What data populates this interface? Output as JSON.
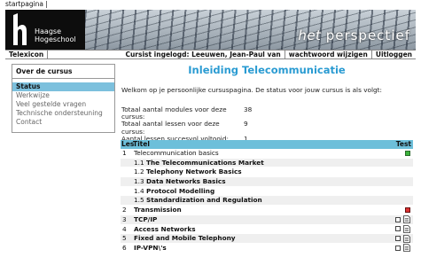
{
  "top": {
    "link": "startpagina",
    "separator": "|"
  },
  "banner": {
    "logo_line1": "Haagse",
    "logo_line2": "Hogeschool",
    "tagline_prefix": "het ",
    "tagline_main": "perspectief"
  },
  "navbar": {
    "brand": "Telexicon",
    "user": "Cursist ingelogd: Leeuwen, Jean-Paul van",
    "change_password": "wachtwoord wijzigen",
    "logout": "Uitloggen"
  },
  "sidebar": {
    "title": "Over de cursus",
    "items": [
      {
        "label": "Status",
        "active": true
      },
      {
        "label": "Werkwijze"
      },
      {
        "label": "Veel gestelde vragen"
      },
      {
        "label": "Technische ondersteuning"
      },
      {
        "label": "Contact"
      }
    ]
  },
  "main": {
    "title": "Inleiding Telecommunicatie",
    "intro": "Welkom op je persoonlijke cursuspagina. De status voor jouw cursus is als volgt:",
    "stats": [
      {
        "label": "Totaal aantal modules voor deze cursus:",
        "value": "38"
      },
      {
        "label": "Totaal aantal lessen voor deze cursus:",
        "value": "9"
      },
      {
        "label": "Aantal lessen succesvol voltooid:",
        "value": "1"
      }
    ],
    "table": {
      "headers": {
        "les": "Les",
        "title": "Titel",
        "test": "Test"
      },
      "rows": [
        {
          "les": "1",
          "num": "",
          "title": "Telecommunication basics",
          "bold": false,
          "alt": false,
          "status": "green",
          "doc": false
        },
        {
          "les": "",
          "num": "1.1",
          "title": "The Telecommunications Market",
          "bold": true,
          "alt": true,
          "status": "",
          "doc": false
        },
        {
          "les": "",
          "num": "1.2",
          "title": "Telephony Network Basics",
          "bold": true,
          "alt": false,
          "status": "",
          "doc": false
        },
        {
          "les": "",
          "num": "1.3",
          "title": "Data Networks Basics",
          "bold": true,
          "alt": true,
          "status": "",
          "doc": false
        },
        {
          "les": "",
          "num": "1.4",
          "title": "Protocol Modelling",
          "bold": true,
          "alt": false,
          "status": "",
          "doc": false
        },
        {
          "les": "",
          "num": "1.5",
          "title": "Standardization and Regulation",
          "bold": true,
          "alt": true,
          "status": "",
          "doc": false
        },
        {
          "les": "2",
          "num": "",
          "title": "Transmission",
          "bold": true,
          "alt": false,
          "status": "red",
          "doc": false
        },
        {
          "les": "3",
          "num": "",
          "title": "TCP/IP",
          "bold": true,
          "alt": true,
          "status": "empty",
          "doc": true
        },
        {
          "les": "4",
          "num": "",
          "title": "Access Networks",
          "bold": true,
          "alt": false,
          "status": "empty",
          "doc": true
        },
        {
          "les": "5",
          "num": "",
          "title": "Fixed and Mobile Telephony",
          "bold": true,
          "alt": true,
          "status": "empty",
          "doc": true
        },
        {
          "les": "6",
          "num": "",
          "title": "IP-VPN\\'s",
          "bold": true,
          "alt": false,
          "status": "empty",
          "doc": true
        }
      ]
    }
  },
  "colors": {
    "accent": "#2a9bd2",
    "table_header": "#6dbfda",
    "sidebar_active": "#7cc0dd",
    "status_green": "#3bb33b",
    "status_red": "#dd3333"
  }
}
